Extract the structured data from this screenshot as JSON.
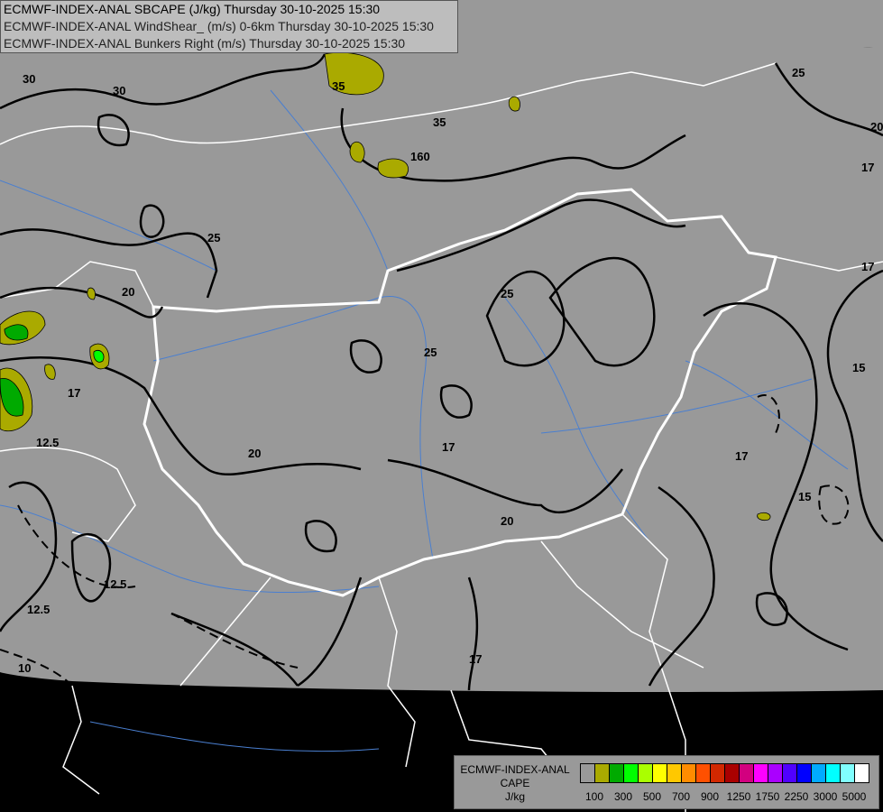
{
  "titles": [
    "ECMWF-INDEX-ANAL SBCAPE (J/kg) Thursday 30-10-2025 15:30",
    "ECMWF-INDEX-ANAL WindShear_ (m/s) 0-6km Thursday 30-10-2025 15:30",
    "ECMWF-INDEX-ANAL Bunkers Right (m/s) Thursday 30-10-2025 15:30"
  ],
  "legend": {
    "line1": "ECMWF-INDEX-ANAL",
    "line2": "CAPE",
    "line3": "J/kg",
    "colors": [
      "#999999",
      "#aaaa00",
      "#00aa00",
      "#00ff00",
      "#aaff00",
      "#ffff00",
      "#ffc800",
      "#ff8c00",
      "#ff5000",
      "#d22800",
      "#aa0000",
      "#d2007f",
      "#ff00ff",
      "#aa00ff",
      "#5000ff",
      "#0000ff",
      "#00aaff",
      "#00ffff",
      "#80ffff",
      "#ffffff"
    ],
    "tick_labels": [
      "100",
      "300",
      "500",
      "700",
      "900",
      "1250",
      "1750",
      "2250",
      "3000",
      "5000"
    ]
  },
  "map": {
    "domain_color": "#999999",
    "outside_color": "#000000",
    "border_color": "#ffffff",
    "river_color": "#4a7fd0",
    "contour_color": "#000000",
    "contour_labels": [
      "30",
      "30",
      "35",
      "35",
      "160",
      "25",
      "20",
      "25",
      "25",
      "17",
      "20",
      "20",
      "17",
      "15",
      "17",
      "15",
      "12.5",
      "12.5",
      "12.5",
      "10",
      "17",
      "17",
      "25",
      "20",
      "17"
    ]
  }
}
